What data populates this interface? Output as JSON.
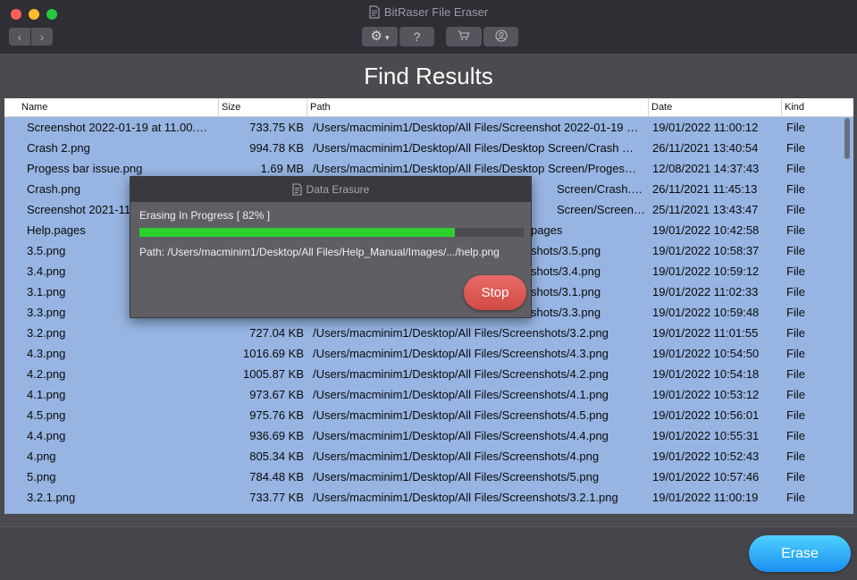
{
  "app": {
    "title": "BitRaser File Eraser"
  },
  "toolbar": {
    "back_icon": "chevron-left-icon",
    "forward_icon": "chevron-right-icon",
    "settings_icon": "gear-icon",
    "help_label": "?",
    "cart_icon": "cart-icon",
    "account_icon": "user-icon"
  },
  "page": {
    "title": "Find Results"
  },
  "table": {
    "columns": {
      "name": "Name",
      "size": "Size",
      "path": "Path",
      "date": "Date",
      "kind": "Kind"
    },
    "rows": [
      {
        "name": "Screenshot 2022-01-19 at 11.00.…",
        "size": "733.75 KB",
        "path": "/Users/macminim1/Desktop/All Files/Screenshot 2022-01-19 …",
        "date": "19/01/2022 11:00:12",
        "kind": "File"
      },
      {
        "name": "Crash 2.png",
        "size": "994.78 KB",
        "path": "/Users/macminim1/Desktop/All Files/Desktop Screen/Crash …",
        "date": "26/11/2021 13:40:54",
        "kind": "File"
      },
      {
        "name": "Progess bar issue.png",
        "size": "1.69 MB",
        "path": "/Users/macminim1/Desktop/All Files/Desktop Screen/Proges…",
        "date": "12/08/2021 14:37:43",
        "kind": "File"
      },
      {
        "name": "Crash.png",
        "size": "",
        "path": "Screen/Crash.…",
        "date": "26/11/2021 11:45:13",
        "kind": "File"
      },
      {
        "name": "Screenshot 2021-11",
        "size": "",
        "path": "Screen/Screen…",
        "date": "25/11/2021 13:43:47",
        "kind": "File"
      },
      {
        "name": "Help.pages",
        "size": "",
        "path": "pages",
        "date": "19/01/2022 10:42:58",
        "kind": "File"
      },
      {
        "name": "3.5.png",
        "size": "",
        "path": "shots/3.5.png",
        "date": "19/01/2022 10:58:37",
        "kind": "File"
      },
      {
        "name": "3.4.png",
        "size": "",
        "path": "shots/3.4.png",
        "date": "19/01/2022 10:59:12",
        "kind": "File"
      },
      {
        "name": "3.1.png",
        "size": "",
        "path": "shots/3.1.png",
        "date": "19/01/2022 11:02:33",
        "kind": "File"
      },
      {
        "name": "3.3.png",
        "size": "",
        "path": "shots/3.3.png",
        "date": "19/01/2022 10:59:48",
        "kind": "File"
      },
      {
        "name": "3.2.png",
        "size": "727.04 KB",
        "path": "/Users/macminim1/Desktop/All Files/Screenshots/3.2.png",
        "date": "19/01/2022 11:01:55",
        "kind": "File"
      },
      {
        "name": "4.3.png",
        "size": "1016.69 KB",
        "path": "/Users/macminim1/Desktop/All Files/Screenshots/4.3.png",
        "date": "19/01/2022 10:54:50",
        "kind": "File"
      },
      {
        "name": "4.2.png",
        "size": "1005.87 KB",
        "path": "/Users/macminim1/Desktop/All Files/Screenshots/4.2.png",
        "date": "19/01/2022 10:54:18",
        "kind": "File"
      },
      {
        "name": "4.1.png",
        "size": "973.67 KB",
        "path": "/Users/macminim1/Desktop/All Files/Screenshots/4.1.png",
        "date": "19/01/2022 10:53:12",
        "kind": "File"
      },
      {
        "name": "4.5.png",
        "size": "975.76 KB",
        "path": "/Users/macminim1/Desktop/All Files/Screenshots/4.5.png",
        "date": "19/01/2022 10:56:01",
        "kind": "File"
      },
      {
        "name": "4.4.png",
        "size": "936.69 KB",
        "path": "/Users/macminim1/Desktop/All Files/Screenshots/4.4.png",
        "date": "19/01/2022 10:55:31",
        "kind": "File"
      },
      {
        "name": "4.png",
        "size": "805.34 KB",
        "path": "/Users/macminim1/Desktop/All Files/Screenshots/4.png",
        "date": "19/01/2022 10:52:43",
        "kind": "File"
      },
      {
        "name": "5.png",
        "size": "784.48 KB",
        "path": "/Users/macminim1/Desktop/All Files/Screenshots/5.png",
        "date": "19/01/2022 10:57:46",
        "kind": "File"
      },
      {
        "name": "3.2.1.png",
        "size": "733.77 KB",
        "path": "/Users/macminim1/Desktop/All Files/Screenshots/3.2.1.png",
        "date": "19/01/2022 11:00:19",
        "kind": "File"
      }
    ]
  },
  "dialog": {
    "title": "Data Erasure",
    "status": "Erasing In Progress [ 82% ]",
    "progress": 0.82,
    "path": "Path: /Users/macminim1/Desktop/All Files/Help_Manual/Images/.../help.png",
    "stop_label": "Stop"
  },
  "footer": {
    "erase_label": "Erase"
  },
  "colors": {
    "selection": "#97b4e2",
    "progress": "#2bd02f",
    "stop": "#d9544e",
    "erase": "#1a9af2"
  }
}
